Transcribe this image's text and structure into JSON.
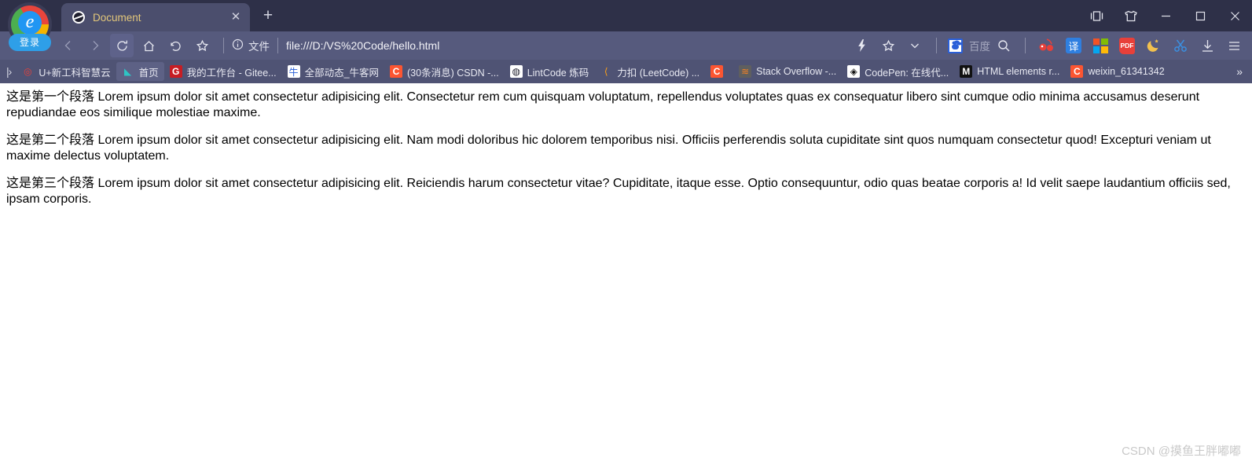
{
  "window": {
    "controls": [
      {
        "name": "split-screen-button",
        "glyph": "split"
      },
      {
        "name": "collections-button",
        "glyph": "shirt"
      },
      {
        "name": "minimize-button",
        "glyph": "minimize"
      },
      {
        "name": "maximize-button",
        "glyph": "maximize"
      },
      {
        "name": "close-button",
        "glyph": "close"
      }
    ]
  },
  "profile": {
    "login_label": "登录"
  },
  "tabs": [
    {
      "title": "Document",
      "favicon": "globe-icon",
      "close_label": "✕"
    }
  ],
  "newtab_label": "+",
  "toolbar": {
    "back_label": "‹",
    "forward_label": "›",
    "reload_label": "⟳",
    "home_label": "⌂",
    "undo_label": "↺",
    "bookmark_star_label": "☆",
    "security_icon": "info-icon",
    "scheme_label": "文件",
    "url": "file:///D:/VS%20Code/hello.html",
    "quick_lightning_label": "⚡",
    "favorite_star_label": "☆",
    "chevron_label": "⌄",
    "engine_label": "百度",
    "search_label": "⌕",
    "extensions": [
      {
        "name": "cherry-extension-icon",
        "label": "🍒"
      },
      {
        "name": "translate-extension-icon",
        "label": "译"
      },
      {
        "name": "microsoft-apps-icon",
        "label": ""
      },
      {
        "name": "pdf-extension-icon",
        "label": "PDF"
      },
      {
        "name": "dark-mode-moon-icon",
        "label": "🌙"
      },
      {
        "name": "scissors-capture-icon",
        "label": "✂"
      },
      {
        "name": "downloads-icon",
        "label": "⤓"
      },
      {
        "name": "menu-icon",
        "label": "☰"
      }
    ]
  },
  "bookmarks": {
    "lead_label": "|›",
    "overflow_label": "»",
    "items": [
      {
        "label": "U+新工科智慧云",
        "icon": "uplus-icon",
        "icon_class": "ic-uplus",
        "icon_char": "◎",
        "highlight": false
      },
      {
        "label": "首页",
        "icon": "home-leaf-icon",
        "icon_class": "ic-teal",
        "icon_char": "◣",
        "highlight": true
      },
      {
        "label": "我的工作台 - Gitee...",
        "icon": "gitee-icon",
        "icon_class": "ic-gitee",
        "icon_char": "G",
        "highlight": false
      },
      {
        "label": "全部动态_牛客网",
        "icon": "nowcoder-icon",
        "icon_class": "ic-nowcoder",
        "icon_char": "牛",
        "highlight": false
      },
      {
        "label": "(30条消息) CSDN -...",
        "icon": "csdn-icon",
        "icon_class": "ic-csdn",
        "icon_char": "C",
        "highlight": false
      },
      {
        "label": "LintCode 炼码",
        "icon": "lintcode-icon",
        "icon_class": "ic-globe",
        "icon_char": "◍",
        "highlight": false
      },
      {
        "label": "力扣 (LeetCode) ...",
        "icon": "leetcode-icon",
        "icon_class": "ic-leet",
        "icon_char": "⟨",
        "highlight": false
      },
      {
        "label": "",
        "icon": "csdn-icon-2",
        "icon_class": "ic-csdn",
        "icon_char": "C",
        "highlight": false
      },
      {
        "label": "Stack Overflow -...",
        "icon": "stackoverflow-icon",
        "icon_class": "ic-so",
        "icon_char": "≋",
        "highlight": false
      },
      {
        "label": "CodePen: 在线代...",
        "icon": "codepen-icon",
        "icon_class": "ic-codepen",
        "icon_char": "◈",
        "highlight": false
      },
      {
        "label": "HTML elements r...",
        "icon": "mdn-icon",
        "icon_class": "ic-mdn",
        "icon_char": "M",
        "highlight": false
      },
      {
        "label": "weixin_61341342",
        "icon": "csdn-icon-3",
        "icon_class": "ic-csdn",
        "icon_char": "C",
        "highlight": false
      }
    ]
  },
  "content": {
    "paragraphs": [
      "这是第一个段落 Lorem ipsum dolor sit amet consectetur adipisicing elit. Consectetur rem cum quisquam voluptatum, repellendus voluptates quas ex consequatur libero sint cumque odio minima accusamus deserunt repudiandae eos similique molestiae maxime.",
      "这是第二个段落 Lorem ipsum dolor sit amet consectetur adipisicing elit. Nam modi doloribus hic dolorem temporibus nisi. Officiis perferendis soluta cupiditate sint quos numquam consectetur quod! Excepturi veniam ut maxime delectus voluptatem.",
      "这是第三个段落 Lorem ipsum dolor sit amet consectetur adipisicing elit. Reiciendis harum consectetur vitae? Cupiditate, itaque esse. Optio consequuntur, odio quas beatae corporis a! Id velit saepe laudantium officiis sed, ipsam corporis."
    ],
    "watermark": "CSDN @摸鱼王胖嘟嘟"
  },
  "colors": {
    "tabstrip_bg": "#2e3048",
    "toolbar_bg": "#565a7d",
    "bookmarks_bg": "#4f5374",
    "active_tab_bg": "#4b4e6d",
    "tab_title": "#e3c77a",
    "page_bg": "#ffffff",
    "text": "#000000"
  }
}
